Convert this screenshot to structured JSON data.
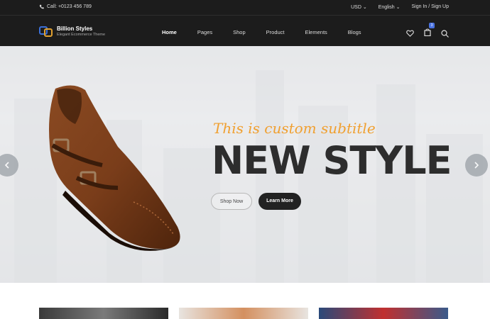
{
  "topbar": {
    "call": "Call: +0123 456 789",
    "currency": "USD",
    "language": "English",
    "signin": "Sign In / Sign Up"
  },
  "brand": {
    "name": "Billion Styles",
    "tagline": "Elegant Ecommerce Theme"
  },
  "menu": [
    {
      "label": "Home",
      "active": true
    },
    {
      "label": "Pages"
    },
    {
      "label": "Shop"
    },
    {
      "label": "Product"
    },
    {
      "label": "Elements"
    },
    {
      "label": "Blogs"
    }
  ],
  "cart": {
    "count": "3"
  },
  "hero": {
    "subtitle": "This is custom subtitle",
    "headline": "NEW STYLE",
    "shop_label": "Shop Now",
    "learn_label": "Learn More"
  },
  "colors": {
    "accent": "#f0a030",
    "dark": "#1c1c1c",
    "badge": "#4a72e0"
  }
}
